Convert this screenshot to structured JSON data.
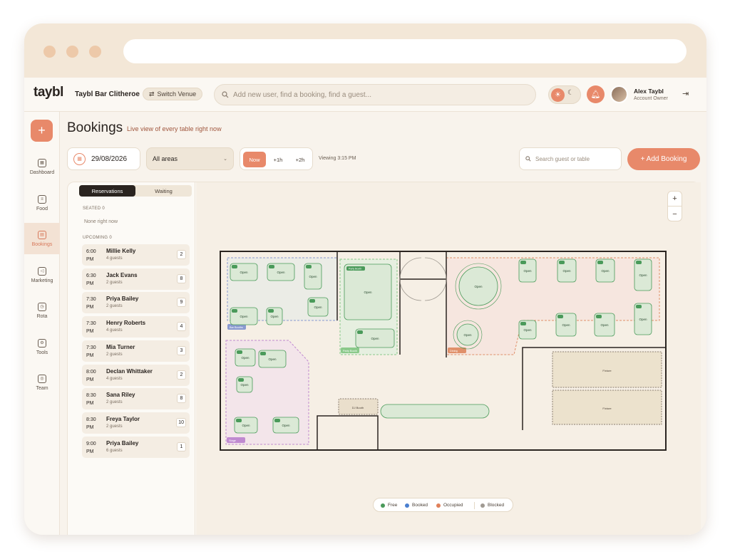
{
  "header": {
    "logo": "taybl",
    "venue": "Taybl Bar Clitheroe",
    "switch_venue": "Switch Venue",
    "search_placeholder": "Add new user, find a booking, find a guest...",
    "user_name": "Alex Taybl",
    "user_role": "Account Owner"
  },
  "sidebar": {
    "items": [
      {
        "label": "Dashboard",
        "icon": "dashboard-icon"
      },
      {
        "label": "Food",
        "icon": "food-icon"
      },
      {
        "label": "Bookings",
        "icon": "bookings-icon",
        "active": true
      },
      {
        "label": "Marketing",
        "icon": "megaphone-icon"
      },
      {
        "label": "Rota",
        "icon": "rota-icon"
      },
      {
        "label": "Tools",
        "icon": "tools-icon"
      },
      {
        "label": "Team",
        "icon": "team-icon"
      }
    ]
  },
  "page": {
    "title": "Bookings",
    "subtitle": "Live view of every table right now"
  },
  "toolbar": {
    "date": "29/08/2026",
    "area": "All areas",
    "time_buttons": [
      "Now",
      "+1h",
      "+2h"
    ],
    "viewing": "Viewing 3:15 PM",
    "search_placeholder": "Search guest or table",
    "add_booking": "+ Add Booking"
  },
  "bookings_panel": {
    "tabs": [
      "Reservations",
      "Waiting"
    ],
    "seated_header": "SEATED 0",
    "seated_empty": "None right now",
    "upcoming_header": "UPCOMING 0",
    "upcoming": [
      {
        "time": "6:00",
        "ampm": "PM",
        "name": "Millie Kelly",
        "guests": "4 guests",
        "table": "2"
      },
      {
        "time": "6:30",
        "ampm": "PM",
        "name": "Jack Evans",
        "guests": "2 guests",
        "table": "8"
      },
      {
        "time": "7:30",
        "ampm": "PM",
        "name": "Priya Bailey",
        "guests": "2 guests",
        "table": "9"
      },
      {
        "time": "7:30",
        "ampm": "PM",
        "name": "Henry Roberts",
        "guests": "4 guests",
        "table": "4"
      },
      {
        "time": "7:30",
        "ampm": "PM",
        "name": "Mia Turner",
        "guests": "2 guests",
        "table": "3"
      },
      {
        "time": "8:00",
        "ampm": "PM",
        "name": "Declan Whittaker",
        "guests": "4 guests",
        "table": "2"
      },
      {
        "time": "8:30",
        "ampm": "PM",
        "name": "Sana Riley",
        "guests": "2 guests",
        "table": "8"
      },
      {
        "time": "8:30",
        "ampm": "PM",
        "name": "Freya Taylor",
        "guests": "2 guests",
        "table": "10"
      },
      {
        "time": "9:00",
        "ampm": "PM",
        "name": "Priya Bailey",
        "guests": "6 guests",
        "table": "1"
      }
    ]
  },
  "floorplan": {
    "open_label": "Open",
    "zone_labels": [
      "Bar Booths",
      "Party Booth",
      "Dining",
      "Stage"
    ],
    "party_booth_title": "Party Booth",
    "dj_booth": "DJ Booth",
    "fixture": "Fixture",
    "colors": {
      "free": "#4a9a5a",
      "booked": "#4a7fd0",
      "occupied": "#e0805a",
      "blocked": "#a09a92"
    }
  },
  "legend": [
    "Free",
    "Booked",
    "Occupied",
    "Blocked"
  ]
}
